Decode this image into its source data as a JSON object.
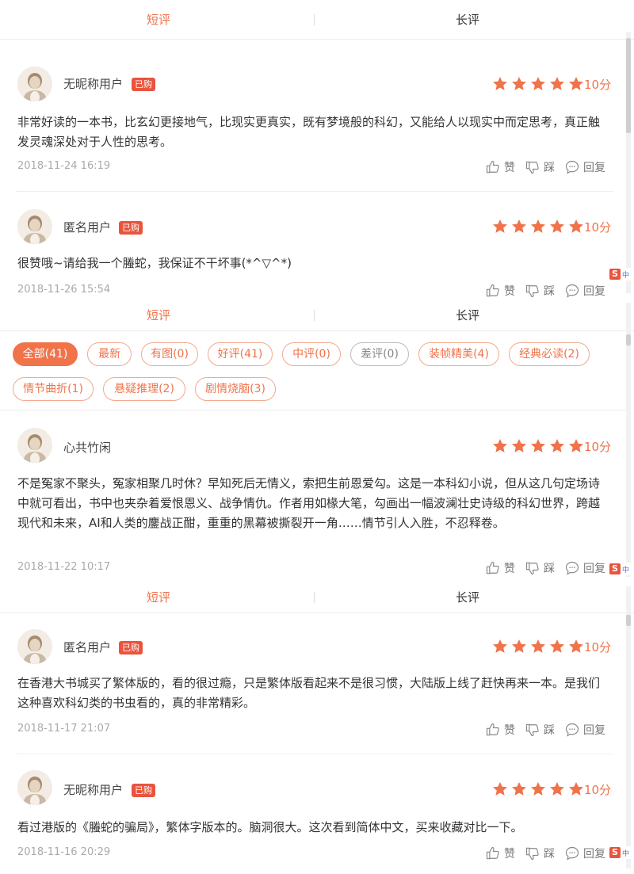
{
  "tabs": {
    "short": "短评",
    "long": "长评"
  },
  "badge_bought": "已购",
  "actions": {
    "like": "赞",
    "dislike": "踩",
    "reply": "回复"
  },
  "filters": [
    "全部(41)",
    "最新",
    "有图(0)",
    "好评(41)",
    "中评(0)",
    "差评(0)",
    "装帧精美(4)",
    "经典必读(2)",
    "情节曲折(1)",
    "悬疑推理(2)",
    "剧情烧脑(3)"
  ],
  "ime": {
    "logo": "S",
    "label": "中"
  },
  "colors": {
    "accent": "#f0734a",
    "badge": "#e9543d",
    "star": "#f0734a"
  },
  "panel1": {
    "reviews": [
      {
        "user": "无昵称用户",
        "bought": true,
        "stars": 5,
        "score": "10分",
        "text": "非常好读的一本书，比玄幻更接地气，比现实更真实，既有梦境般的科幻，又能给人以现实中而定思考，真正触发灵魂深处对于人性的思考。",
        "date": "2018-11-24 16:19"
      },
      {
        "user": "匿名用户",
        "bought": true,
        "stars": 5,
        "score": "10分",
        "text": "很赞哦~请给我一个螣蛇，我保证不干坏事(*^▽^*)",
        "date": "2018-11-26 15:54"
      }
    ]
  },
  "panel2": {
    "reviews": [
      {
        "user": "心共竹闲",
        "bought": false,
        "stars": 5,
        "score": "10分",
        "text": "不是冤家不聚头，冤家相聚几时休？早知死后无情义，索把生前恩爱勾。这是一本科幻小说，但从这几句定场诗中就可看出，书中也夹杂着爱恨恩义、战争情仇。作者用如椽大笔，勾画出一幅波澜壮史诗级的科幻世界，跨越现代和未来，AI和人类的鏖战正酣，重重的黑幕被撕裂开一角……情节引人入胜，不忍释卷。",
        "date": "2018-11-22 10:17"
      }
    ]
  },
  "panel3": {
    "reviews": [
      {
        "user": "匿名用户",
        "bought": true,
        "stars": 5,
        "score": "10分",
        "text": "在香港大书城买了繁体版的，看的很过瘾，只是繁体版看起来不是很习惯，大陆版上线了赶快再来一本。是我们这种喜欢科幻类的书虫看的，真的非常精彩。",
        "date": "2018-11-17 21:07"
      },
      {
        "user": "无昵称用户",
        "bought": true,
        "stars": 5,
        "score": "10分",
        "text": "看过港版的《螣蛇的骗局》，繁体字版本的。脑洞很大。这次看到简体中文，买来收藏对比一下。",
        "date": "2018-11-16 20:29"
      }
    ]
  }
}
